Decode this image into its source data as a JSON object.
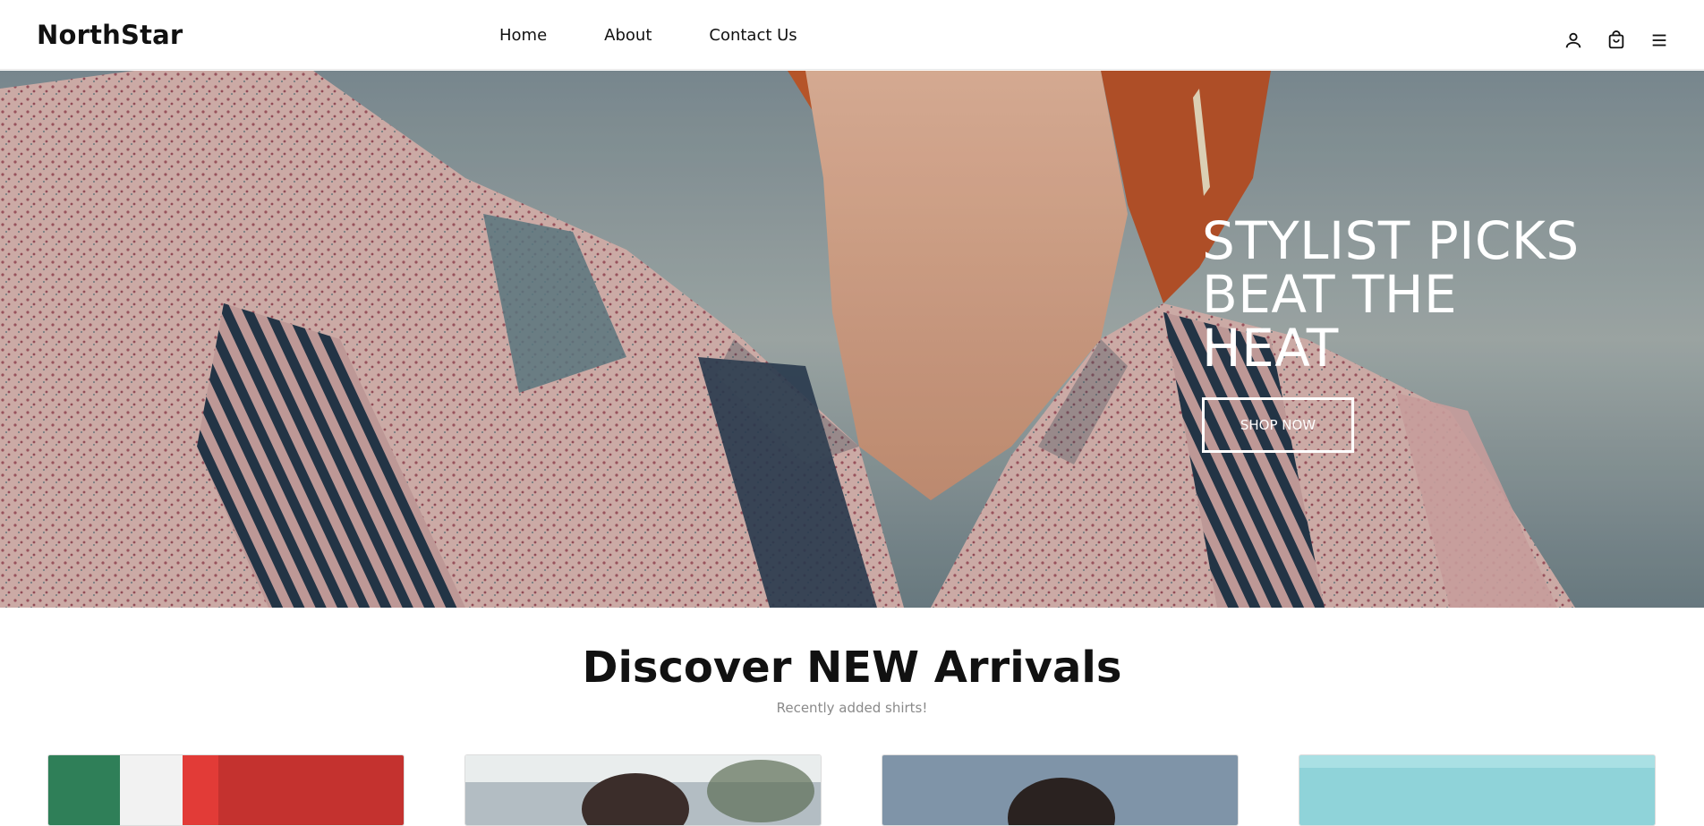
{
  "brand": {
    "name": "NorthStar"
  },
  "nav": {
    "links": [
      {
        "label": "Home"
      },
      {
        "label": "About"
      },
      {
        "label": "Contact Us"
      }
    ],
    "icons": [
      "user-icon",
      "shopping-bag-icon",
      "menu-icon"
    ]
  },
  "hero": {
    "headline_lines": [
      "STYLIST PICKS",
      "BEAT THE",
      "HEAT"
    ],
    "cta_label": "SHOP NOW"
  },
  "section": {
    "title": "Discover NEW Arrivals",
    "subtitle": "Recently added shirts!"
  },
  "products": [
    {
      "color": "#c4322f"
    },
    {
      "color": "#8f9da6"
    },
    {
      "color": "#7f94a8"
    },
    {
      "color": "#8fd3d9"
    }
  ],
  "colors": {
    "text_primary": "#111111",
    "text_muted": "#8a8a8a",
    "hero_text": "#ffffff"
  }
}
